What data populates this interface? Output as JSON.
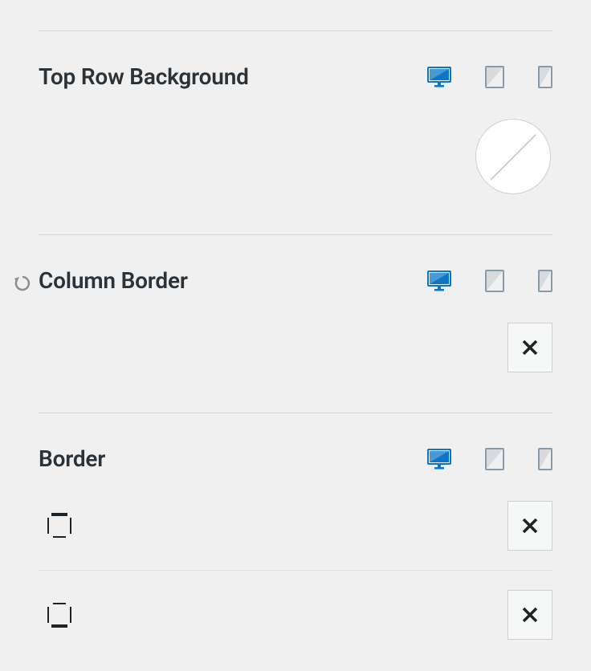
{
  "sections": {
    "topRowBackground": {
      "title": "Top Row Background"
    },
    "columnBorder": {
      "title": "Column Border"
    },
    "border": {
      "title": "Border"
    }
  },
  "icons": {
    "desktop": "desktop-icon",
    "tablet": "tablet-icon",
    "mobile": "mobile-icon",
    "reset": "reset-icon",
    "close": "close-icon",
    "borderTop": "border-top-icon",
    "borderBottom": "border-bottom-icon"
  },
  "colors": {
    "active": "#0e76c6",
    "inactive": "#8a9ba8",
    "text": "#2c3338"
  }
}
